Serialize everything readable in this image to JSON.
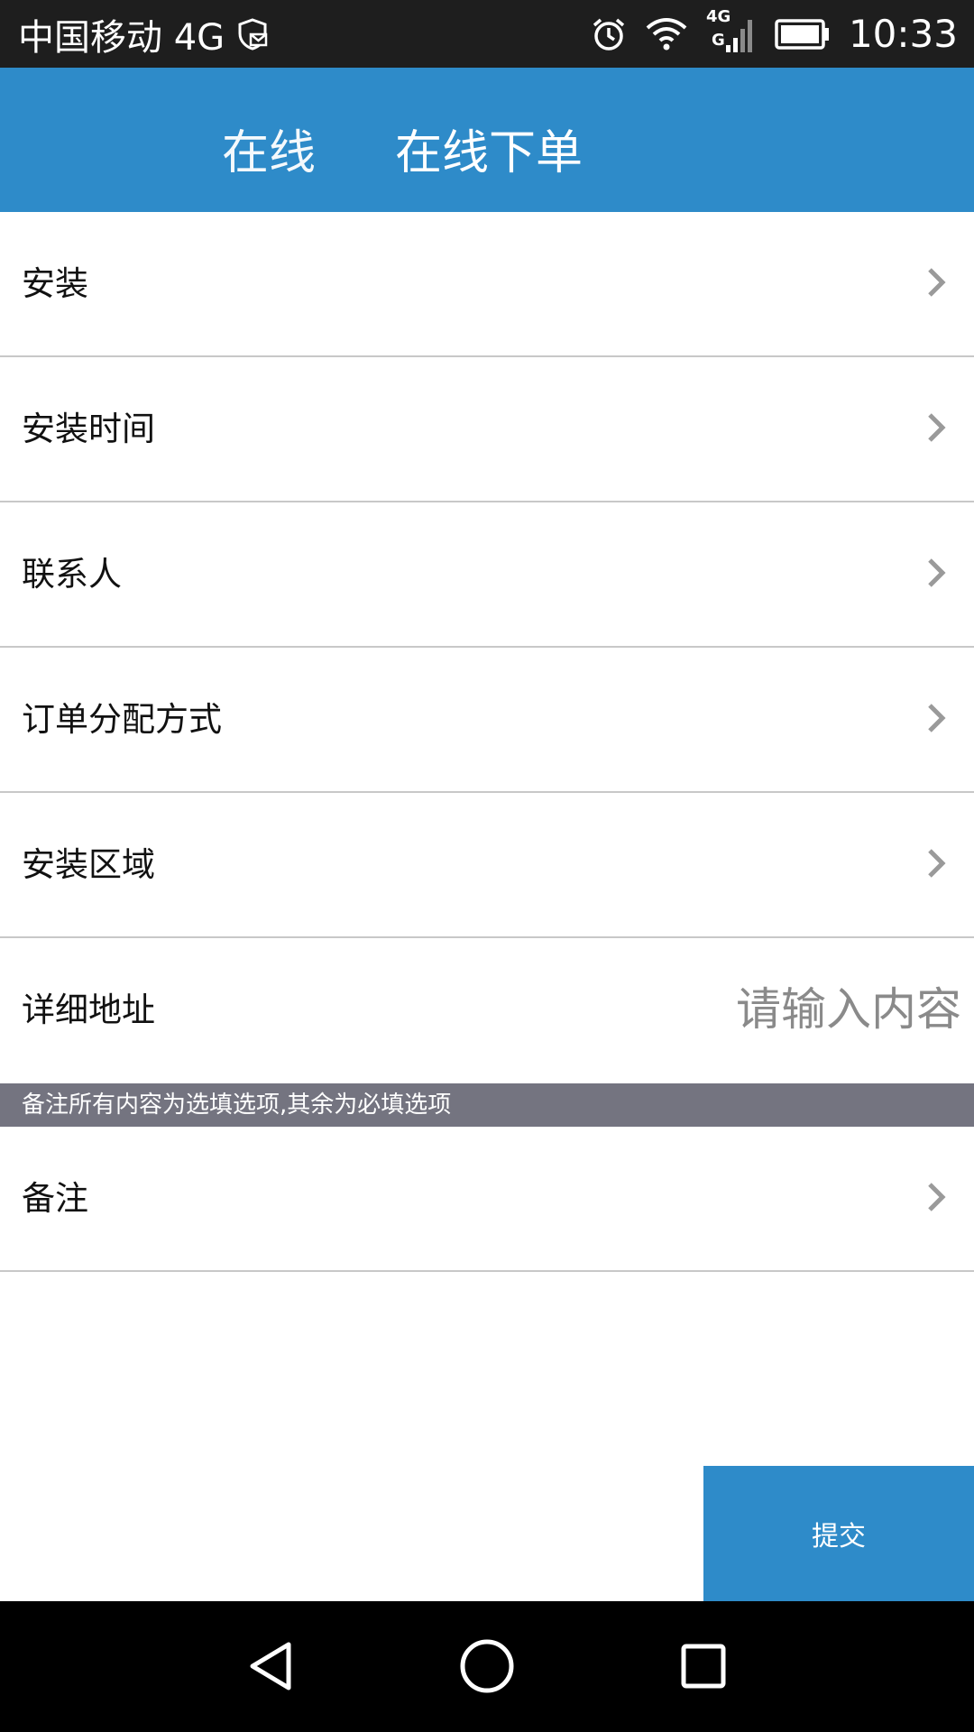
{
  "status_bar": {
    "carrier": "中国移动 4G",
    "network_small_top": "4G",
    "network_small_bottom": "G",
    "time": "10:33"
  },
  "header": {
    "ghost_title": "在线",
    "title": "在线下单"
  },
  "form": {
    "rows": [
      {
        "label": "安装"
      },
      {
        "label": "安装时间"
      },
      {
        "label": "联系人"
      },
      {
        "label": "订单分配方式"
      },
      {
        "label": "安装区域"
      },
      {
        "label": "详细地址",
        "placeholder": "请输入内容"
      }
    ],
    "hint": "备注所有内容为选填选项,其余为必填选项",
    "remark": {
      "label": "备注"
    }
  },
  "submit": {
    "label": "提交"
  },
  "colors": {
    "accent": "#2e8bc9",
    "hint_bar": "#747480",
    "status_bar": "#1e1e1e",
    "nav_bar": "#000000"
  },
  "icons": {
    "chevron": "chevron-right-icon",
    "alarm": "alarm-icon",
    "wifi": "wifi-icon",
    "battery": "battery-icon",
    "signal": "signal-icon",
    "shield": "shield-mail-icon"
  }
}
